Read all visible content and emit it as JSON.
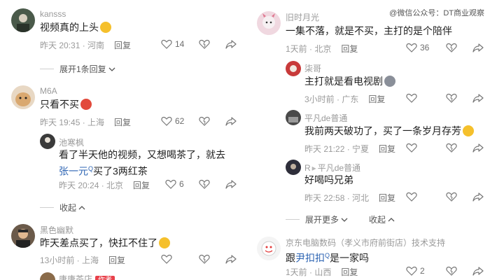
{
  "watermark": "@微信公众号：DT商业观察",
  "left": {
    "c1": {
      "user": "kansss",
      "text": "视频真的上头",
      "time": "昨天 20:31 · 河南",
      "reply": "回复",
      "likes": "14"
    },
    "c1_more": "展开1条回复",
    "c2": {
      "user": "M6A",
      "text": "只看不买",
      "time": "昨天 19:45 · 上海",
      "reply": "回复",
      "likes": "62"
    },
    "c2r": {
      "user": "池寒枫",
      "text1": "看了半天他的视频，又想喝茶了，就去",
      "link": "张一元",
      "text2": "买了3两红茶",
      "time": "昨天 20:24 · 北京",
      "reply": "回复",
      "likes": "6"
    },
    "c2_collapse": "收起",
    "c3": {
      "user": "黑色幽默",
      "text": "昨天差点买了，快扛不住了",
      "time": "13小时前 · 上海",
      "reply": "回复"
    },
    "c3r": {
      "user": "唐唐茶店",
      "badge": "作者"
    }
  },
  "right": {
    "c1": {
      "user": "旧时月光",
      "text": "一集不落，就是不买，主打的是个陪伴",
      "time": "1天前 · 北京",
      "reply": "回复",
      "likes": "36"
    },
    "c1r1": {
      "user": "柒哥",
      "text": "主打就是看电视剧",
      "time": "3小时前 · 广东",
      "reply": "回复"
    },
    "c1r2": {
      "user": "平凡de普通",
      "text": "我前两天破功了，买了一条岁月存芳",
      "time": "昨天 21:22 · 宁夏",
      "reply": "回复"
    },
    "c1r3": {
      "user": "R",
      "to": "平凡de普通",
      "text": "好喝吗兄弟",
      "time": "昨天 22:58 · 河北",
      "reply": "回复"
    },
    "c1_more": "展开更多",
    "c1_collapse": "收起",
    "c2": {
      "user": "京东电脑数码（孝义市府前街店）技术支持",
      "text1": "跟",
      "link": "尹扣扣",
      "text2": "是一家吗",
      "time": "1天前 · 山西",
      "reply": "回复",
      "likes": "2"
    }
  }
}
